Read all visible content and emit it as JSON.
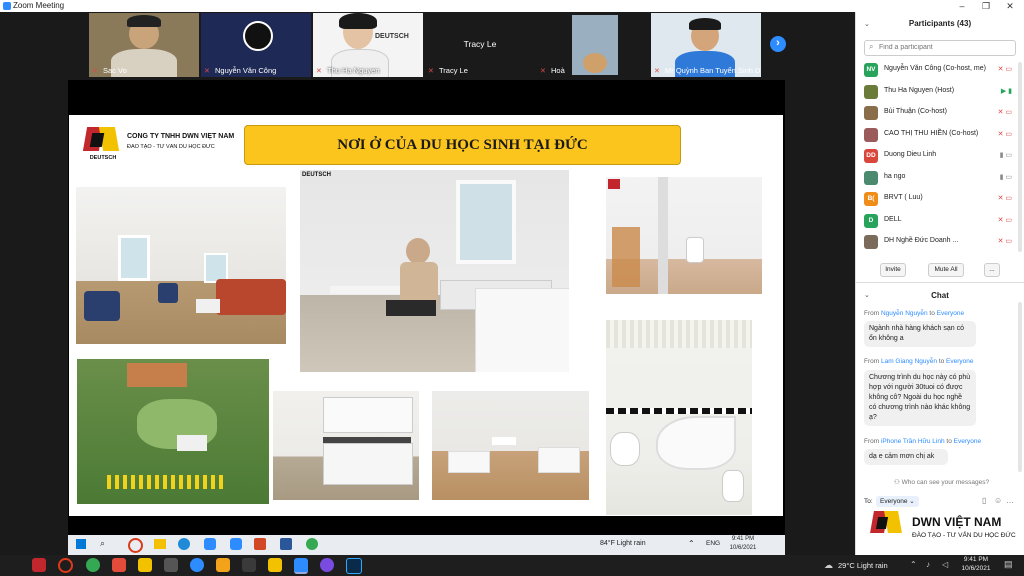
{
  "window": {
    "title": "Zoom Meeting"
  },
  "video_strip": {
    "tiles": [
      {
        "name": "Sac Vo"
      },
      {
        "name": "Nguyễn Văn Công"
      },
      {
        "name": "Thu Ha Nguyen"
      },
      {
        "name": "Tracy Le"
      },
      {
        "name": "Hoà"
      },
      {
        "name": "Mr Quỳnh Ban Tuyển Sinh DW..."
      }
    ]
  },
  "slide": {
    "company_name": "CÔNG TY TNHH DWN VIỆT NAM",
    "company_tagline": "ĐÀO TẠO - TƯ VẤN DU HỌC ĐỨC",
    "logo_word": "DEUTSCH",
    "title": "NƠI Ở CỦA DU HỌC SINH TẠI ĐỨC"
  },
  "inner_taskbar": {
    "weather": "84°F  Light rain",
    "lang": "ENG",
    "time": "9:41 PM",
    "date": "10/6/2021"
  },
  "participants": {
    "header": "Participants (43)",
    "search_placeholder": "Find a participant",
    "list": [
      {
        "initials": "NV",
        "name": "Nguyễn Văn Công (Co-host, me)",
        "color": "#27a35b"
      },
      {
        "initials": "",
        "name": "Thu Ha Nguyen (Host)",
        "color": "#6b7b3a"
      },
      {
        "initials": "",
        "name": "Bùi Thuận (Co-host)",
        "color": "#8a6e4b"
      },
      {
        "initials": "",
        "name": "CAO THỊ THU HIỀN (Co-host)",
        "color": "#9b5b5b"
      },
      {
        "initials": "DD",
        "name": "Duong Dieu Linh",
        "color": "#d9463b"
      },
      {
        "initials": "",
        "name": "ha ngo",
        "color": "#4b8a6e"
      },
      {
        "initials": "B(",
        "name": "BRVT ( Luu)",
        "color": "#f08c1a"
      },
      {
        "initials": "D",
        "name": "DELL",
        "color": "#27a35b"
      },
      {
        "initials": "",
        "name": "DH Nghề Đức Doanh ...",
        "color": "#7b6b5b"
      }
    ],
    "invite": "Invite",
    "mute_all": "Mute All",
    "more": "..."
  },
  "chat": {
    "header": "Chat",
    "messages": [
      {
        "from": "Nguyễn Nguyễn",
        "to": "Everyone",
        "text": "Ngành nhà hàng khách sạn có ổn không a"
      },
      {
        "from": "Lam Giang Nguyễn",
        "to": "Everyone",
        "text": "Chương trình du học này có phù hợp với người 30tuoi có được không cô? Ngoài du học nghề có chương trình nào khác không ạ?"
      },
      {
        "from": "iPhone Trần Hữu Linh",
        "to": "Everyone",
        "text": "dạ e cảm mơn chị ak"
      }
    ],
    "from_word": "From",
    "to_word": "to",
    "privacy_note": "Who can see your messages?",
    "to_label": "To:",
    "to_value": "Everyone"
  },
  "watermark": {
    "brand": "DWN VIỆT NAM",
    "tagline": "ĐÀO TẠO - TƯ VẤN DU HỌC ĐỨC"
  },
  "taskbar": {
    "weather": "29°C  Light rain",
    "time": "9:41 PM",
    "date": "10/6/2021"
  }
}
